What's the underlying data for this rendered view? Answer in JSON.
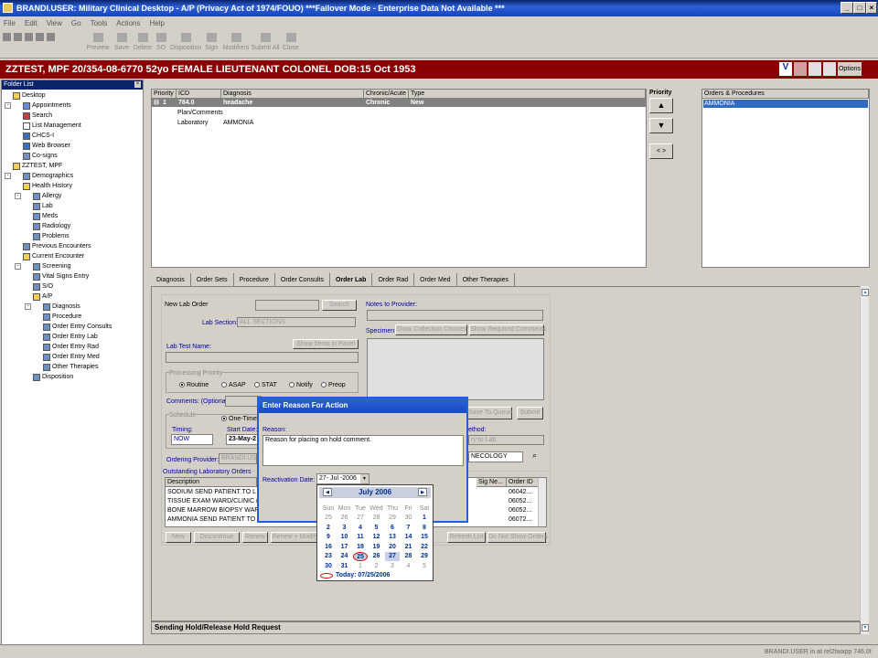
{
  "window": {
    "title": "BRANDI.USER: Military Clinical Desktop - A/P (Privacy Act of 1974/FOUO) ***Failover Mode - Enterprise Data Not Available ***"
  },
  "menu": [
    "File",
    "Edit",
    "View",
    "Go",
    "Tools",
    "Actions",
    "Help"
  ],
  "toolbar": [
    "Preview",
    "Save",
    "Delete",
    "SO",
    "Disposition",
    "Sign",
    "Modifiers",
    "Submit All",
    "Close"
  ],
  "patient": {
    "banner": "ZZTEST, MPF  20/354-08-6770  52yo  FEMALE  LIEUTENANT COLONEL  DOB:15 Oct 1953",
    "options": "Options"
  },
  "folder": {
    "title": "Folder List",
    "items": [
      "Desktop",
      "Appointments",
      "Search",
      "List Management",
      "CHCS-I",
      "Web Browser",
      "Co-signs",
      "ZZTEST, MPF",
      "Demographics",
      "Health History",
      "Allergy",
      "Lab",
      "Meds",
      "Radiology",
      "Problems",
      "Previous Encounters",
      "Current Encounter",
      "Screening",
      "Vital Signs Entry",
      "S/O",
      "A/P",
      "Diagnosis",
      "Procedure",
      "Order Entry Consults",
      "Order Entry Lab",
      "Order Entry Rad",
      "Order Entry Med",
      "Other Therapies",
      "Disposition"
    ]
  },
  "dx_grid": {
    "headers": [
      "Priority",
      "ICD",
      "Diagnosis",
      "Chronic/Acute",
      "Type"
    ],
    "row": {
      "priority": "1",
      "icd": "784.0",
      "diagnosis": "headache",
      "chronic": "Chronic",
      "type": "New"
    },
    "sub": [
      [
        "Plan/Comments",
        ""
      ],
      [
        "Laboratory",
        "AMMONIA"
      ]
    ]
  },
  "priority": {
    "label": "Priority",
    "up": "▲",
    "down": "▼",
    "swap": "< >"
  },
  "orders": {
    "header": "Orders & Procedures",
    "items": [
      "AMMONIA"
    ]
  },
  "tabs": [
    "Diagnosis",
    "Order Sets",
    "Procedure",
    "Order Consults",
    "Order Lab",
    "Order Rad",
    "Order Med",
    "Other Therapies"
  ],
  "form": {
    "new_lab_order": "New Lab Order",
    "search": "Search",
    "lab_section_label": "Lab Section:",
    "lab_section": "ALL SECTIONS",
    "lab_test_label": "Lab Test Name:",
    "show_items": "Show Items in Panel",
    "processing_priority": "Processing Priority",
    "priorities": [
      "Routine",
      "ASAP",
      "STAT",
      "Notify",
      "Preop"
    ],
    "comments_label": "Comments: (Optional)",
    "schedule": "Schedule",
    "one_time": "One-Time",
    "timing_label": "Timing:",
    "timing": "NOW",
    "start_date_label": "Start Date:",
    "start_date": "23-May-2",
    "ordering_provider_label": "Ordering Provider:",
    "ordering_provider": "BRANDI.USER",
    "notes_label": "Notes to Provider:",
    "specimen_label": "Specimen:",
    "show_collection": "Show Collection Choices",
    "show_required": "Show Required Comments",
    "save_queue": "Save To Queue",
    "submit": "Submit",
    "method_label": "ethod:",
    "method": "ry to Lab",
    "necology": "NECOLOGY"
  },
  "outstanding": {
    "title": "Outstanding Laboratory Orders",
    "headers": [
      "Description",
      "Sig Ne...",
      "Order ID"
    ],
    "rows": [
      [
        "SODIUM   SEND PATIENT TO L",
        "06042..."
      ],
      [
        "TISSUE EXAM  WARD/CLINIC (",
        "06052..."
      ],
      [
        "BONE MARROW BIOPSY  WAF",
        "06052..."
      ],
      [
        "AMMONIA   SEND PATIENT TO",
        "06072..."
      ]
    ],
    "buttons": [
      "New",
      "Discontinue",
      "Renew",
      "Renew + Modify",
      "Refresh List",
      "Do Not Show Orders"
    ]
  },
  "dialog": {
    "title": "Enter Reason For Action",
    "reason_label": "Reason:",
    "reason": "Reason for placing on hold comment.",
    "reactivation_label": "Reactivation Date:",
    "reactivation_date": "27- Jul -2006"
  },
  "calendar": {
    "month": "July 2006",
    "dow": [
      "Sun",
      "Mon",
      "Tue",
      "Wed",
      "Thu",
      "Fri",
      "Sat"
    ],
    "weeks": [
      [
        "25",
        "26",
        "27",
        "28",
        "29",
        "30",
        "1"
      ],
      [
        "2",
        "3",
        "4",
        "5",
        "6",
        "7",
        "8"
      ],
      [
        "9",
        "10",
        "11",
        "12",
        "13",
        "14",
        "15"
      ],
      [
        "16",
        "17",
        "18",
        "19",
        "20",
        "21",
        "22"
      ],
      [
        "23",
        "24",
        "25",
        "26",
        "27",
        "28",
        "29"
      ],
      [
        "30",
        "31",
        "1",
        "2",
        "3",
        "4",
        "5"
      ]
    ],
    "today": "Today: 07/25/2006"
  },
  "status": {
    "message": "Sending Hold/Release Hold Request",
    "user": "BRANDI.USER in  at rel2twapp 746.0t"
  }
}
